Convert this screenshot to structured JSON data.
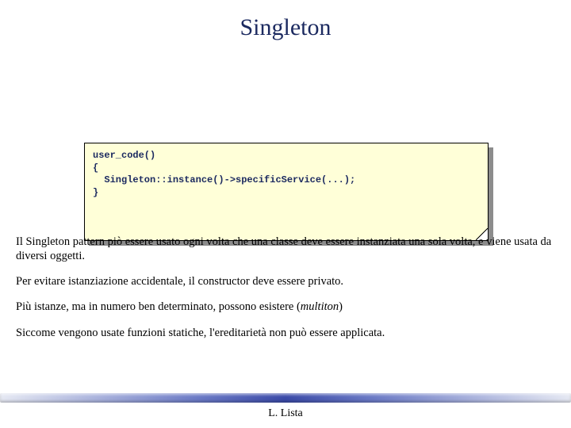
{
  "title": "Singleton",
  "code": {
    "line1": "user_code()",
    "line2": "{",
    "line3": "  Singleton::instance()->specificService(...);",
    "line4": "}"
  },
  "paragraphs": {
    "p1": "Il Singleton pattern piò essere usato ogni volta che una classe deve essere instanziata una sola volta, e viene usata da diversi oggetti.",
    "p2": "Per evitare istanziazione accidentale, il constructor deve essere privato.",
    "p3a": "Più istanze, ma in numero ben determinato, possono esistere (",
    "p3b": "multiton",
    "p3c": ")",
    "p4": "Siccome vengono usate funzioni statiche, l'ereditarietà non può essere applicata."
  },
  "footer": "L. Lista"
}
